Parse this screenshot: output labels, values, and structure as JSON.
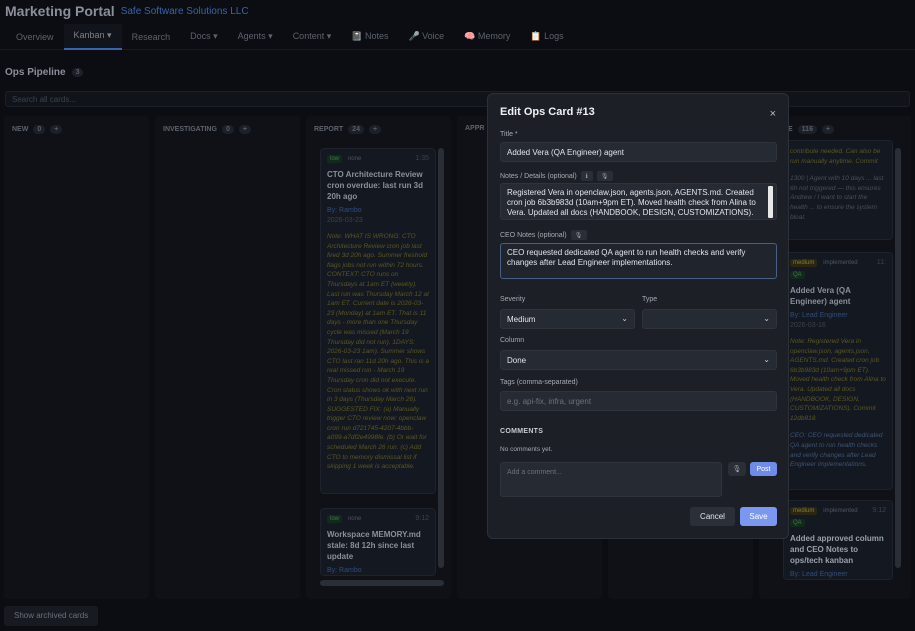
{
  "app": {
    "title": "Marketing Portal",
    "company": "Safe Software Solutions LLC"
  },
  "nav": [
    {
      "label": "Overview"
    },
    {
      "label": "Kanban ▾"
    },
    {
      "label": "Research"
    },
    {
      "label": "Docs ▾"
    },
    {
      "label": "Agents ▾"
    },
    {
      "label": "Content ▾"
    },
    {
      "label": "📓 Notes"
    },
    {
      "label": "🎤 Voice"
    },
    {
      "label": "🧠 Memory"
    },
    {
      "label": "📋 Logs"
    }
  ],
  "board": {
    "title": "Ops Pipeline",
    "count_badge": "3",
    "search_placeholder": "Search all cards...",
    "archived_label": "Show archived cards",
    "columns": [
      {
        "name": "NEW",
        "count": "0",
        "extra": "+"
      },
      {
        "name": "INVESTIGATING",
        "count": "0",
        "extra": "+"
      },
      {
        "name": "REPORT",
        "count": "24",
        "extra": "+"
      },
      {
        "name": "APPR",
        "count": "",
        "extra": ""
      },
      {
        "name": "E",
        "count": "116",
        "extra": "+"
      }
    ],
    "report_cards": [
      {
        "tag": "low",
        "tag2": "none",
        "meta": "1:35",
        "title": "CTO Architecture Review cron overdue: last run 3d 20h ago",
        "by": "By: Rambo",
        "date": "2026-03-23",
        "note": "Note: WHAT IS WRONG: CTO Architecture Review cron job last fired 3d 20h ago. Summer freshold flags jobs not run within 72 hours. CONTEXT: CTO runs on Thursdays at 1am ET (weekly). Last run was Thursday March 12 at 1am ET. Current date is 2026-03-23 (Monday) at 1am ET. That is 11 days - more than one Thursday cycle was missed (March 19 Thursday did not run). 1DAYS: 2026-03-23 1am). Summer shows CTO last ran 11d 20h ago. This is a real missed run - March 19 Thursday cron did not execute. Cron status shows ok with next run in 3 days (Thursday March 26). SUGGESTED FIX: (a) Manually trigger CTO review now: openclaw cron run d721745-4207-4bbb-a099-a7df2e4998fe. (b) Or wait for scheduled March 26 run. (c) Add CTO to memory dismissal list if skipping 1 week is acceptable."
      },
      {
        "tag": "low",
        "tag2": "none",
        "meta": "9:12",
        "title": "Workspace MEMORY.md stale: 8d 12h since last update",
        "by": "By: Rambo"
      }
    ],
    "right_cards": [
      {
        "note_top": "contribute needed. Can also be run manually anytime. Commit",
        "detail": "1300 | Agent with 10 days ... last 6h not triggered — this ensures Andrew / I want to start the health ... to ensure the system bloat."
      },
      {
        "tag": "medium",
        "tag2": "implemented",
        "meta": "11:",
        "sub": "QA",
        "title": "Added Vera (QA Engineer) agent",
        "by": "By: Lead Engineer",
        "date": "2026-03-16",
        "note": "Note: Registered Vera in openclaw.json, agents.json, AGENTS.md. Created cron job 6b3b983d (10am+9pm ET). Moved health check from Alina to Vera. Updated all docs (HANDBOOK, DESIGN, CUSTOMIZATIONS). Commit 12db818.",
        "ceo": "CEO: CEO requested dedicated QA agent to run health checks and verify changes after Lead Engineer implementations."
      },
      {
        "tag": "medium",
        "tag2": "implemented",
        "meta": "9:12",
        "sub": "QA",
        "title": "Added approved column and CEO Notes to ops/tech kanban",
        "by": "By: Lead Engineer"
      }
    ]
  },
  "modal": {
    "title": "Edit Ops Card #13",
    "close": "×",
    "title_label": "Title *",
    "title_value": "Added Vera (QA Engineer) agent",
    "notes_label": "Notes / Details (optional)",
    "notes_value": "Registered Vera in openclaw.json, agents.json, AGENTS.md. Created cron job 6b3b983d (10am+9pm ET). Moved health check from Alina to Vera. Updated all docs (HANDBOOK, DESIGN, CUSTOMIZATIONS). Commit",
    "ceo_label": "CEO Notes (optional)",
    "ceo_value": "CEO requested dedicated QA agent to run health checks and verify changes after Lead Engineer implementations.",
    "severity_label": "Severity",
    "severity_value": "Medium",
    "type_label": "Type",
    "type_value": "",
    "column_label": "Column",
    "column_value": "Done",
    "tags_label": "Tags (comma-separated)",
    "tags_placeholder": "e.g. api-fix, infra, urgent",
    "comments_heading": "COMMENTS",
    "no_comments": "No comments yet.",
    "comment_placeholder": "Add a comment...",
    "post_label": "Post",
    "cancel_label": "Cancel",
    "save_label": "Save"
  }
}
